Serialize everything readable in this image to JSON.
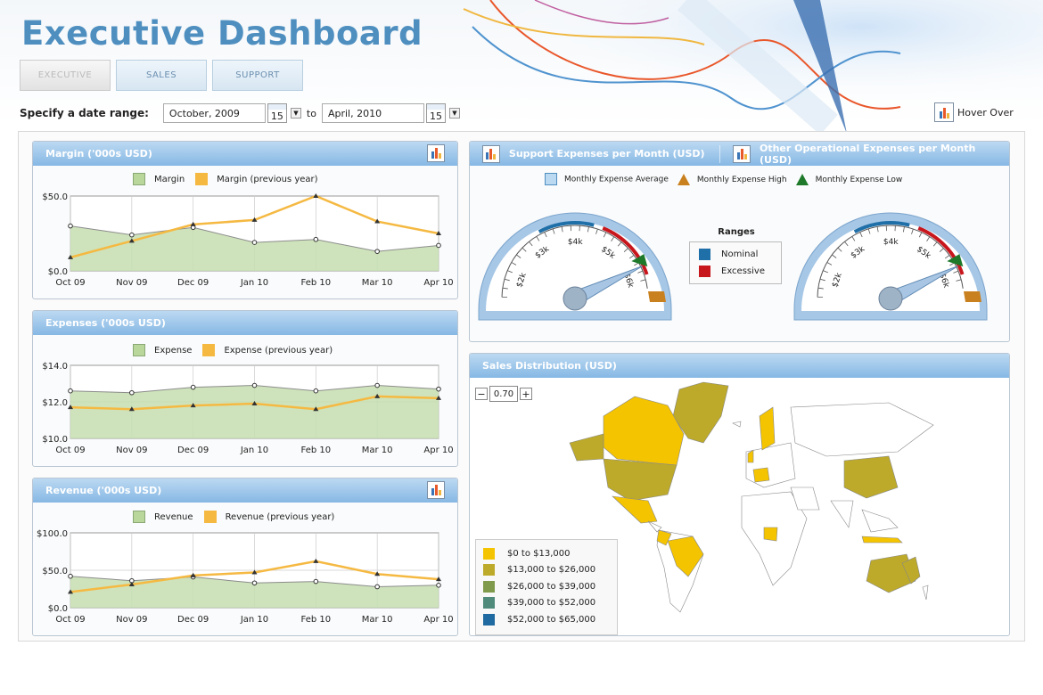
{
  "header": {
    "title": "Executive Dashboard",
    "hover_label": "Hover Over"
  },
  "tabs": [
    {
      "label": "EXECUTIVE",
      "active": true
    },
    {
      "label": "SALES",
      "active": false
    },
    {
      "label": "SUPPORT",
      "active": false
    }
  ],
  "date_range": {
    "label": "Specify a date range:",
    "from": "October, 2009",
    "to_label": "to",
    "to": "April, 2010",
    "calendar_day": "15"
  },
  "colors": {
    "series": "#b9d79b",
    "series_prev": "#f5b942",
    "header": "#86b8e4",
    "nominal": "#1f6fa8",
    "excessive": "#c8161d"
  },
  "chart_data": [
    {
      "type": "area",
      "title": "Margin ('000s USD)",
      "categories": [
        "Oct 09",
        "Nov 09",
        "Dec 09",
        "Jan 10",
        "Feb 10",
        "Mar 10",
        "Apr 10"
      ],
      "ylim": [
        0,
        50
      ],
      "yticks": [
        "$0.0",
        "$50.0"
      ],
      "series": [
        {
          "name": "Margin",
          "values": [
            30,
            24,
            29,
            19,
            21,
            13,
            17
          ]
        },
        {
          "name": "Margin (previous year)",
          "values": [
            9,
            20,
            31,
            34,
            50,
            33,
            25
          ]
        }
      ]
    },
    {
      "type": "area",
      "title": "Expenses ('000s USD)",
      "categories": [
        "Oct 09",
        "Nov 09",
        "Dec 09",
        "Jan 10",
        "Feb 10",
        "Mar 10",
        "Apr 10"
      ],
      "ylim": [
        10,
        14
      ],
      "yticks": [
        "$10.0",
        "$12.0",
        "$14.0"
      ],
      "series": [
        {
          "name": "Expense",
          "values": [
            12.6,
            12.5,
            12.8,
            12.9,
            12.6,
            12.9,
            12.7
          ]
        },
        {
          "name": "Expense (previous year)",
          "values": [
            11.7,
            11.6,
            11.8,
            11.9,
            11.6,
            12.3,
            12.2
          ]
        }
      ]
    },
    {
      "type": "area",
      "title": "Revenue ('000s USD)",
      "categories": [
        "Oct 09",
        "Nov 09",
        "Dec 09",
        "Jan 10",
        "Feb 10",
        "Mar 10",
        "Apr 10"
      ],
      "ylim": [
        0,
        100
      ],
      "yticks": [
        "$0.0",
        "$50.0",
        "$100.0"
      ],
      "series": [
        {
          "name": "Revenue",
          "values": [
            42,
            36,
            41,
            33,
            35,
            28,
            30
          ]
        },
        {
          "name": "Revenue (previous year)",
          "values": [
            21,
            31,
            43,
            47,
            62,
            45,
            38
          ]
        }
      ]
    }
  ],
  "gauges": {
    "title_left": "Support Expenses per Month (USD)",
    "title_right": "Other Operational Expenses per Month (USD)",
    "legend": [
      "Monthly Expense Average",
      "Monthly Expense High",
      "Monthly Expense Low"
    ],
    "ticks": [
      "$2k",
      "$3k",
      "$4k",
      "$5k",
      "$6k"
    ],
    "ranges_title": "Ranges",
    "ranges": [
      "Nominal",
      "Excessive"
    ],
    "values": [
      {
        "average": 5.8
      },
      {
        "average": 5.8
      }
    ]
  },
  "map": {
    "title": "Sales Distribution (USD)",
    "zoom": "0.70",
    "legend": [
      {
        "label": "$0 to $13,000",
        "color": "#f5c400"
      },
      {
        "label": "$13,000 to $26,000",
        "color": "#bdaa2a"
      },
      {
        "label": "$26,000 to $39,000",
        "color": "#7f9a4a"
      },
      {
        "label": "$39,000 to $52,000",
        "color": "#4f8a7a"
      },
      {
        "label": "$52,000 to $65,000",
        "color": "#1f6aa0"
      }
    ]
  }
}
